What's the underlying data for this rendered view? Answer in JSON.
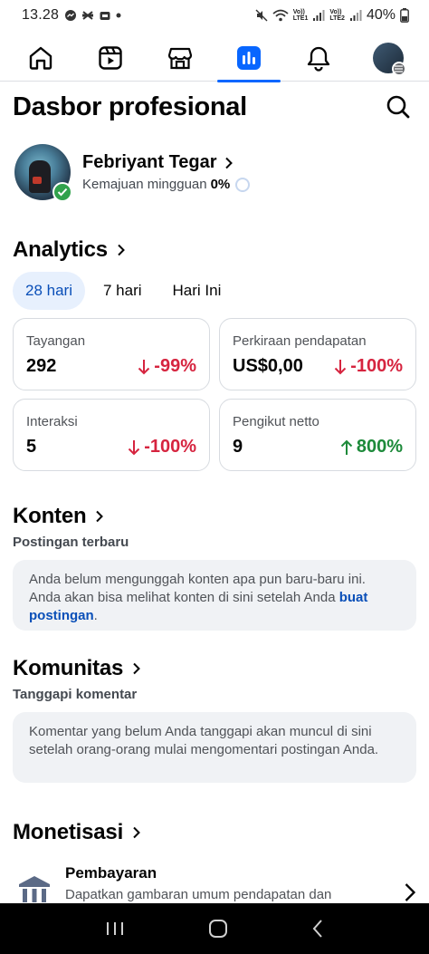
{
  "status_bar": {
    "time": "13.28",
    "lte1": "LTE1",
    "lte2": "LTE2",
    "volte1": "Vo))",
    "volte2": "Vo))",
    "battery": "40%"
  },
  "nav": {
    "items": [
      "home-icon",
      "video-icon",
      "marketplace-icon",
      "dashboard-icon",
      "bell-icon",
      "profile-menu"
    ],
    "active": "dashboard-icon"
  },
  "header": {
    "title": "Dasbor profesional"
  },
  "profile": {
    "name": "Febriyant Tegar",
    "progress_label": "Kemajuan mingguan",
    "progress_value": "0%"
  },
  "analytics": {
    "title": "Analytics",
    "tabs": [
      {
        "label": "28 hari",
        "active": true
      },
      {
        "label": "7 hari",
        "active": false
      },
      {
        "label": "Hari Ini",
        "active": false
      }
    ],
    "cards": [
      {
        "label": "Tayangan",
        "value": "292",
        "change": "-99%",
        "direction": "down"
      },
      {
        "label": "Perkiraan pendapatan",
        "value": "US$0,00",
        "change": "-100%",
        "direction": "down"
      },
      {
        "label": "Interaksi",
        "value": "5",
        "change": "-100%",
        "direction": "down"
      },
      {
        "label": "Pengikut netto",
        "value": "9",
        "change": "800%",
        "direction": "up"
      }
    ]
  },
  "konten": {
    "title": "Konten",
    "subtitle": "Postingan terbaru",
    "message": "Anda belum mengunggah konten apa pun baru-baru ini. Anda akan bisa melihat konten di sini setelah Anda ",
    "link": "buat postingan",
    "message_end": "."
  },
  "komunitas": {
    "title": "Komunitas",
    "subtitle": "Tanggapi komentar",
    "message": "Komentar yang belum Anda tanggapi akan muncul di sini setelah orang-orang mulai mengomentari postingan Anda."
  },
  "monetisasi": {
    "title": "Monetisasi",
    "payment_title": "Pembayaran",
    "payment_desc": "Dapatkan gambaran umum pendapatan dan"
  },
  "colors": {
    "accent": "#0866ff",
    "down": "#d6243f",
    "up": "#1d8a3a",
    "verified": "#31a24c"
  }
}
